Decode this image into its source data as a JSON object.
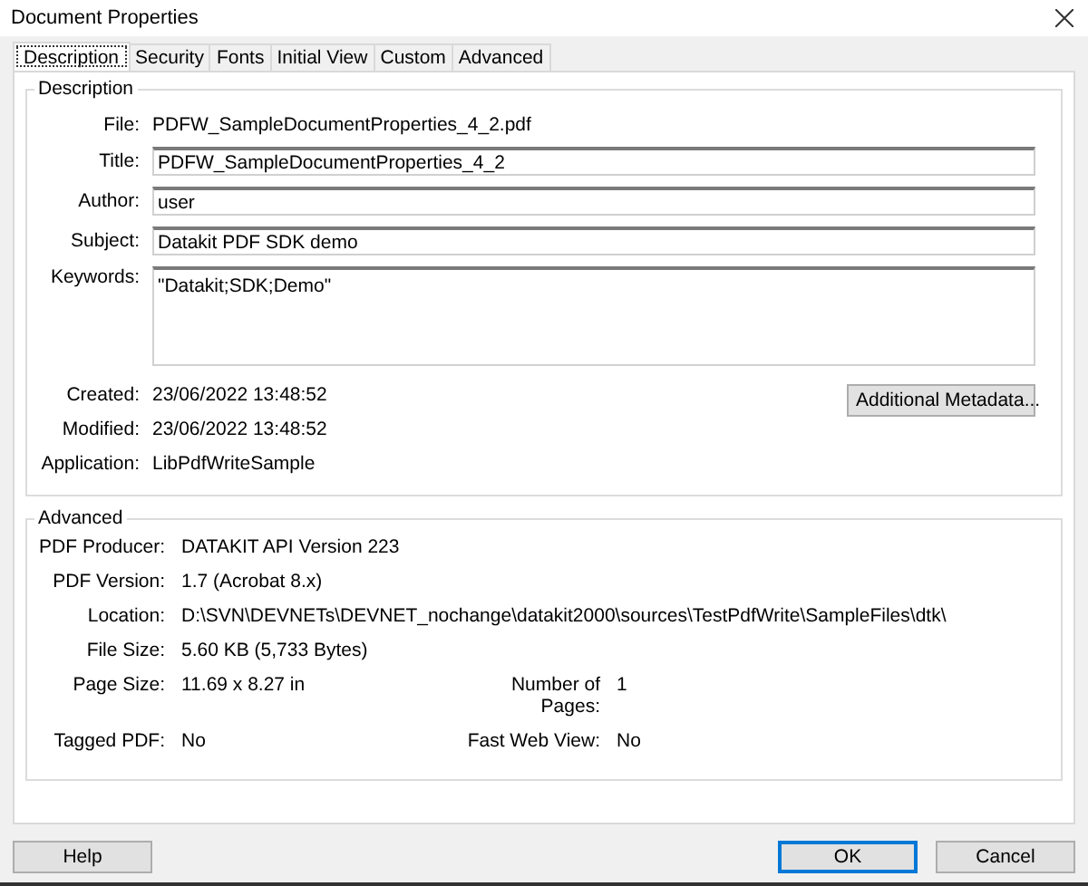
{
  "window": {
    "title": "Document Properties"
  },
  "tabs": [
    {
      "label": "Description",
      "selected": true
    },
    {
      "label": "Security",
      "selected": false
    },
    {
      "label": "Fonts",
      "selected": false
    },
    {
      "label": "Initial View",
      "selected": false
    },
    {
      "label": "Custom",
      "selected": false
    },
    {
      "label": "Advanced",
      "selected": false
    }
  ],
  "description": {
    "legend": "Description",
    "fields": [
      {
        "label": "File:",
        "kind": "text",
        "value": "PDFW_SampleDocumentProperties_4_2.pdf"
      },
      {
        "label": "Title:",
        "kind": "input",
        "value": "PDFW_SampleDocumentProperties_4_2"
      },
      {
        "label": "Author:",
        "kind": "input",
        "value": "user"
      },
      {
        "label": "Subject:",
        "kind": "input",
        "value": "Datakit PDF SDK demo"
      },
      {
        "label": "Keywords:",
        "kind": "textarea",
        "value": "\"Datakit;SDK;Demo\""
      }
    ],
    "dates": [
      {
        "label": "Created:",
        "value": "23/06/2022 13:48:52"
      },
      {
        "label": "Modified:",
        "value": "23/06/2022 13:48:52"
      },
      {
        "label": "Application:",
        "value": "LibPdfWriteSample"
      }
    ],
    "metadata_button": "Additional Metadata..."
  },
  "advanced": {
    "legend": "Advanced",
    "rows": [
      [
        {
          "label": "PDF Producer:",
          "value": "DATAKIT API Version 223"
        }
      ],
      [
        {
          "label": "PDF Version:",
          "value": "1.7 (Acrobat 8.x)"
        }
      ],
      [
        {
          "label": "Location:",
          "value": "D:\\SVN\\DEVNETs\\DEVNET_nochange\\datakit2000\\sources\\TestPdfWrite\\SampleFiles\\dtk\\"
        }
      ],
      [
        {
          "label": "File Size:",
          "value": "5.60 KB (5,733 Bytes)"
        }
      ],
      [
        {
          "label": "Page Size:",
          "value": "11.69 x 8.27 in"
        },
        {
          "label": "Number of Pages:",
          "value": "1"
        }
      ],
      [
        {
          "label": "Tagged PDF:",
          "value": "No"
        },
        {
          "label": "Fast Web View:",
          "value": "No"
        }
      ]
    ]
  },
  "buttons": [
    {
      "label": "Help",
      "default": false
    },
    {
      "label": "OK",
      "default": true
    },
    {
      "label": "Cancel",
      "default": false
    }
  ]
}
